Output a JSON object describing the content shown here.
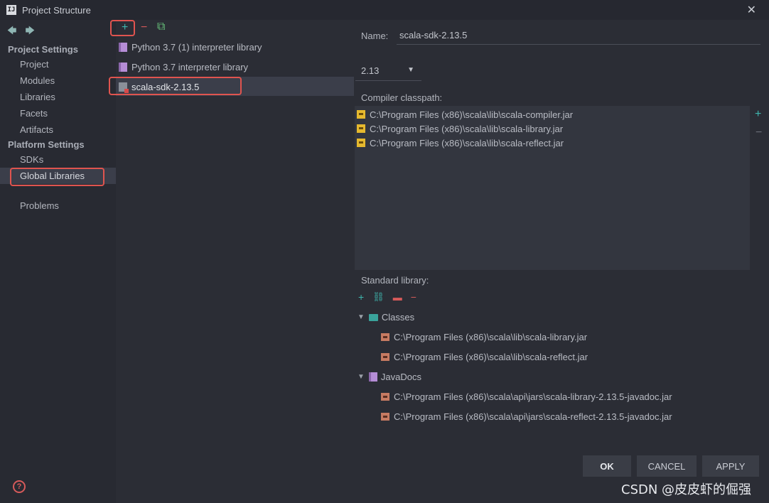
{
  "window": {
    "title": "Project Structure",
    "app_icon": "IJ",
    "close_glyph": "✕"
  },
  "sidebar": {
    "project_settings_heading": "Project Settings",
    "project_items": [
      "Project",
      "Modules",
      "Libraries",
      "Facets",
      "Artifacts"
    ],
    "platform_settings_heading": "Platform Settings",
    "platform_items": [
      "SDKs",
      "Global Libraries"
    ],
    "selected": "Global Libraries",
    "problems": "Problems",
    "back_glyph": "🡄",
    "forward_glyph": "🡆"
  },
  "library_list": {
    "toolbar": {
      "add": "+",
      "remove": "−",
      "copy": "⧉"
    },
    "items": [
      "Python 3.7 (1) interpreter library",
      "Python 3.7 interpreter library",
      "scala-sdk-2.13.5"
    ],
    "selected": "scala-sdk-2.13.5"
  },
  "details": {
    "name_label": "Name:",
    "name_value": "scala-sdk-2.13.5",
    "version": "2.13",
    "compiler_classpath_label": "Compiler classpath:",
    "compiler_classpath": [
      "C:\\Program Files (x86)\\scala\\lib\\scala-compiler.jar",
      "C:\\Program Files (x86)\\scala\\lib\\scala-library.jar",
      "C:\\Program Files (x86)\\scala\\lib\\scala-reflect.jar"
    ],
    "standard_library_label": "Standard library:",
    "classes_label": "Classes",
    "classes": [
      "C:\\Program Files (x86)\\scala\\lib\\scala-library.jar",
      "C:\\Program Files (x86)\\scala\\lib\\scala-reflect.jar"
    ],
    "javadocs_label": "JavaDocs",
    "javadocs": [
      "C:\\Program Files (x86)\\scala\\api\\jars\\scala-library-2.13.5-javadoc.jar",
      "C:\\Program Files (x86)\\scala\\api\\jars\\scala-reflect-2.13.5-javadoc.jar"
    ]
  },
  "buttons": {
    "ok": "OK",
    "cancel": "CANCEL",
    "apply": "APPLY"
  },
  "watermark": "CSDN @皮皮虾的倔强",
  "colors": {
    "accent_teal": "#3fb6ae",
    "highlight_red": "#e0544f",
    "selection_bg": "#3b3e4a"
  }
}
